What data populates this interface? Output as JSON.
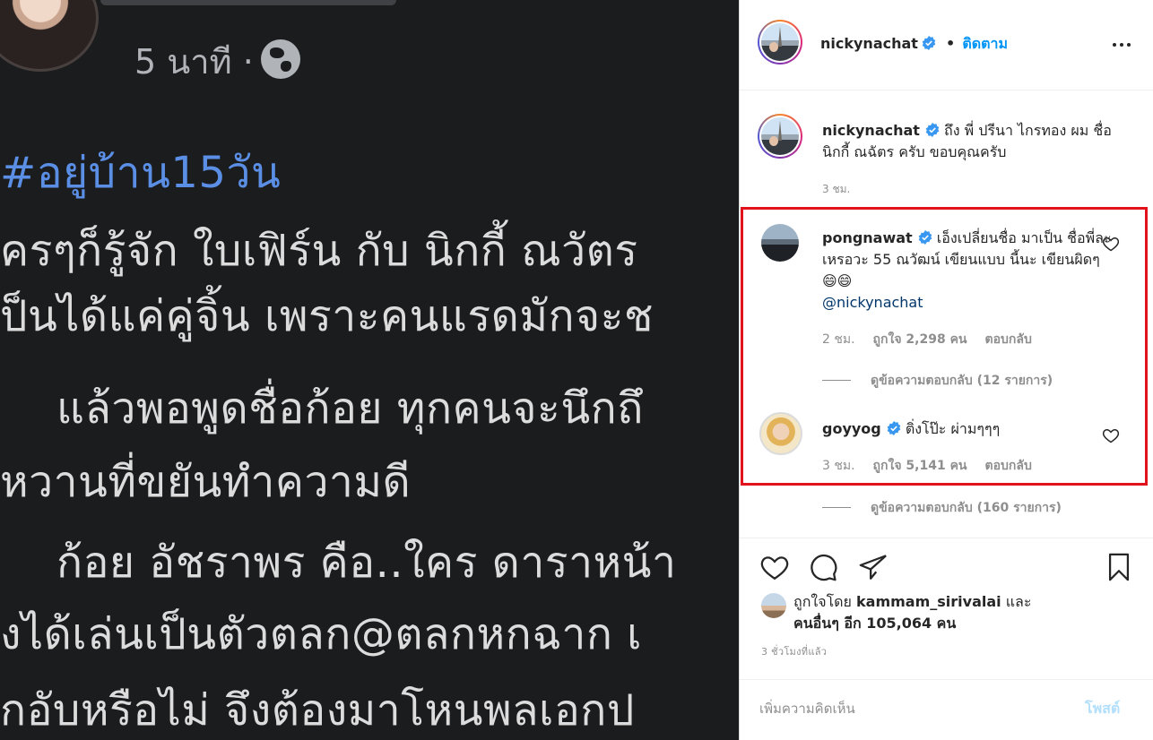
{
  "left_post": {
    "meta": "5 นาที ·",
    "hashtag": "#อยู่บ้าน15วัน",
    "lines": [
      "ครๆก็รู้จัก ใบเฟิร์น กับ นิกกี้ ณวัตร",
      "ป็นได้แค่คู่จิ้น เพราะคนแรดมักจะช",
      "    แล้วพอพูดชื่อก้อย ทุกคนจะนึกถึ",
      "หวานที่ขยันทำความดี",
      "    ก้อย อัชราพร คือ..ใคร ดาราหน้า",
      "งได้เล่นเป็นตัวตลก@ตลกหกฉาก เ",
      "กอับหรือไม่ จึงต้องมาโหนพลเอกป"
    ]
  },
  "header": {
    "username": "nickynachat",
    "separator": "•",
    "follow_label": "ติดตาม",
    "more_icon": "more-horizontal-icon"
  },
  "caption": {
    "username": "nickynachat",
    "text": "ถึง พี่ ปรีนา ไกรทอง ผม ชื่อ นิกกี้ ณฉัตร ครับ ขอบคุณครับ",
    "time": "3 ชม."
  },
  "comments": [
    {
      "username": "pongnawat",
      "text": "เอ็งเปลี่ยนชื่อ มาเป็น ชื่อพี่ละเหรอวะ 55 ณวัฒน์ เขียนแบบ นี้นะ เขียนผิดๆ 😄😄",
      "mention": "@nickynachat",
      "time": "2 ชม.",
      "likes": "ถูกใจ 2,298 คน",
      "reply_label": "ตอบกลับ",
      "view_replies": "ดูข้อความตอบกลับ (12 รายการ)"
    },
    {
      "username": "goyyog",
      "text": "ติ่งโป๊ะ ผ่ามๆๆๆ",
      "time": "3 ชม.",
      "likes": "ถูกใจ 5,141 คน",
      "reply_label": "ตอบกลับ",
      "view_replies": "ดูข้อความตอบกลับ (160 รายการ)"
    }
  ],
  "likes_summary": {
    "prefix": "ถูกใจโดย",
    "liker": "kammam_sirivalai",
    "joiner": "และ",
    "others": "คนอื่นๆ อีก 105,064 คน"
  },
  "timestamp": "3 ชั่วโมงที่แล้ว",
  "add_comment": {
    "placeholder": "เพิ่มความคิดเห็น",
    "post_label": "โพสต์"
  },
  "colors": {
    "link_blue": "#0095f6",
    "highlight_red": "#e1121b",
    "muted": "#8e8e8e",
    "dark_bg": "#1b1c1e"
  },
  "icons": [
    "verified-badge-icon",
    "heart-icon",
    "comment-icon",
    "share-icon",
    "bookmark-icon",
    "globe-icon"
  ]
}
